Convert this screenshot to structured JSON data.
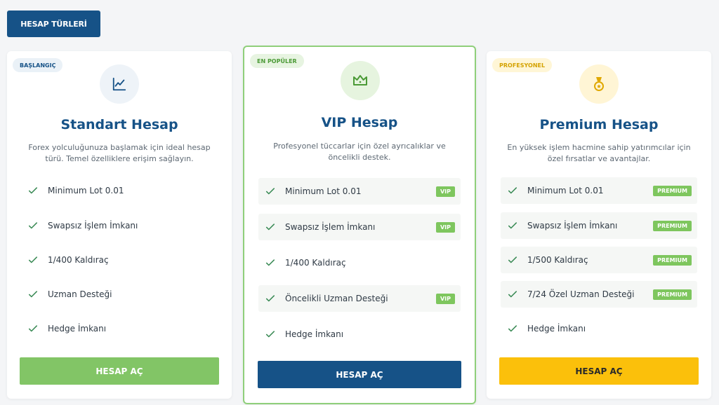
{
  "header": {
    "tab_label": "HESAP TÜRLERİ"
  },
  "colors": {
    "primary": "#165287",
    "green": "#82c566",
    "yellow": "#fbc00b",
    "check": "#3a8a55"
  },
  "cards": [
    {
      "badge": "BAŞLANGIÇ",
      "icon": "chart-line-icon",
      "title": "Standart Hesap",
      "description": "Forex yolculuğunuza başlamak için ideal hesap türü. Temel özelliklere erişim sağlayın.",
      "features": [
        {
          "text": "Minimum Lot 0.01"
        },
        {
          "text": "Swapsız İşlem İmkanı"
        },
        {
          "text": "1/400 Kaldıraç"
        },
        {
          "text": "Uzman Desteği"
        },
        {
          "text": "Hedge İmkanı"
        }
      ],
      "cta": "HESAP AÇ"
    },
    {
      "badge": "EN POPÜLER",
      "icon": "crown-icon",
      "title": "VIP Hesap",
      "description": "Profesyonel tüccarlar için özel ayrıcalıklar ve öncelikli destek.",
      "features": [
        {
          "text": "Minimum Lot 0.01",
          "tag": "VIP"
        },
        {
          "text": "Swapsız İşlem İmkanı",
          "tag": "VIP"
        },
        {
          "text": "1/400 Kaldıraç"
        },
        {
          "text": "Öncelikli Uzman Desteği",
          "tag": "VIP"
        },
        {
          "text": "Hedge İmkanı"
        }
      ],
      "cta": "HESAP AÇ"
    },
    {
      "badge": "PROFESYONEL",
      "icon": "medal-icon",
      "title": "Premium Hesap",
      "description": "En yüksek işlem hacmine sahip yatırımcılar için özel fırsatlar ve avantajlar.",
      "features": [
        {
          "text": "Minimum Lot 0.01",
          "tag": "PREMIUM"
        },
        {
          "text": "Swapsız İşlem İmkanı",
          "tag": "PREMIUM"
        },
        {
          "text": "1/500 Kaldıraç",
          "tag": "PREMIUM"
        },
        {
          "text": "7/24 Özel Uzman Desteği",
          "tag": "PREMIUM"
        },
        {
          "text": "Hedge İmkanı"
        }
      ],
      "cta": "HESAP AÇ"
    }
  ]
}
